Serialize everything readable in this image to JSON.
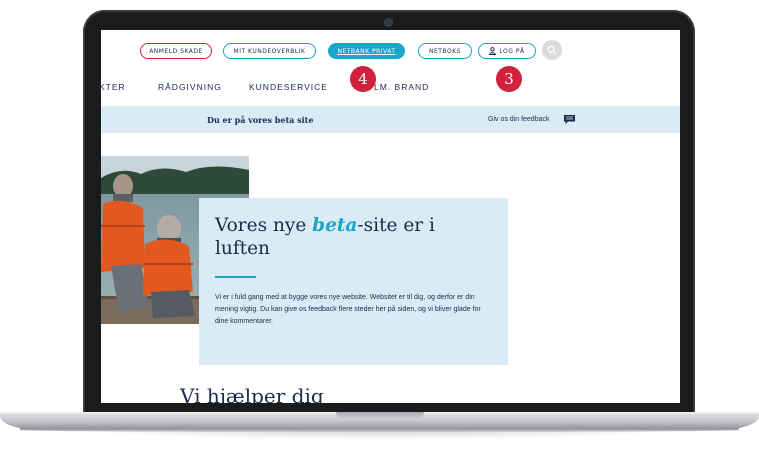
{
  "topnav": {
    "report_claim": "ANMELD SKADE",
    "my_overview": "MIT KUNDEOVERBLIK",
    "netbank": "NETBANK PRIVAT",
    "netboks": "NETBOKS",
    "login": "LOG PÅ"
  },
  "menu": {
    "products_partial": "KTER",
    "advice": "RÅDGIVNING",
    "customer_service": "KUNDESERVICE",
    "brand_partial": "LM. BRAND"
  },
  "badges": {
    "four": "4",
    "three": "3"
  },
  "beta_bar": {
    "text": "Du er på vores beta site",
    "feedback": "Giv os din feedback"
  },
  "hero": {
    "title_before": "Vores nye ",
    "title_emphasis": "beta",
    "title_after": "-site er i luften",
    "body": "Vi er i fuld gang med at bygge vores nye website. Websitet er til dig, og derfor er din mening vigtig. Du kan give os feedback flere steder her på siden, og vi bliver glade for dine kommentarer."
  },
  "section": {
    "help_title": "Vi hjælper dig"
  },
  "colors": {
    "accent": "#16a7c9",
    "brand_red": "#d2213c",
    "navy": "#1c2b4a",
    "light_blue": "#d9ebf5"
  }
}
